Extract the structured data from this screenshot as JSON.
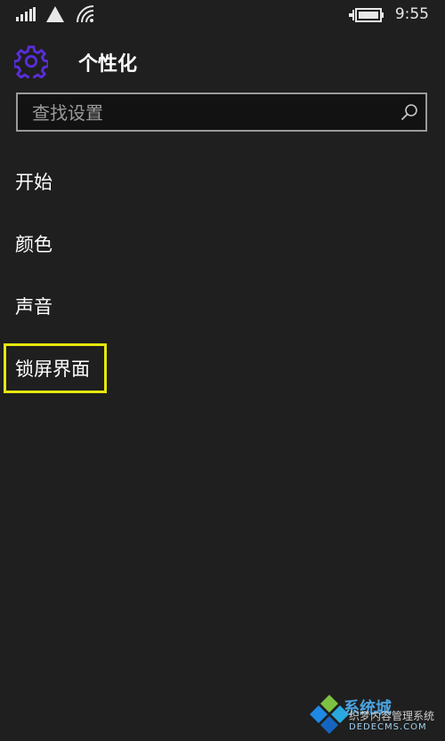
{
  "status_bar": {
    "time": "9:55",
    "icons": [
      "signal-bars-icon",
      "network-triangle-icon",
      "wifi-icon",
      "battery-charging-icon"
    ]
  },
  "header": {
    "title": "个性化",
    "icon": "gear-icon",
    "accent_color": "#5a2ddb"
  },
  "search": {
    "placeholder": "查找设置",
    "value": ""
  },
  "menu": {
    "items": [
      {
        "label": "开始"
      },
      {
        "label": "颜色"
      },
      {
        "label": "声音"
      },
      {
        "label": "锁屏界面",
        "highlighted": true
      }
    ],
    "highlight_color": "#e6e60f"
  },
  "watermark": {
    "brand": "系统城",
    "line1": "织梦内容管理系统",
    "line2": "DEDECMS.COM"
  }
}
